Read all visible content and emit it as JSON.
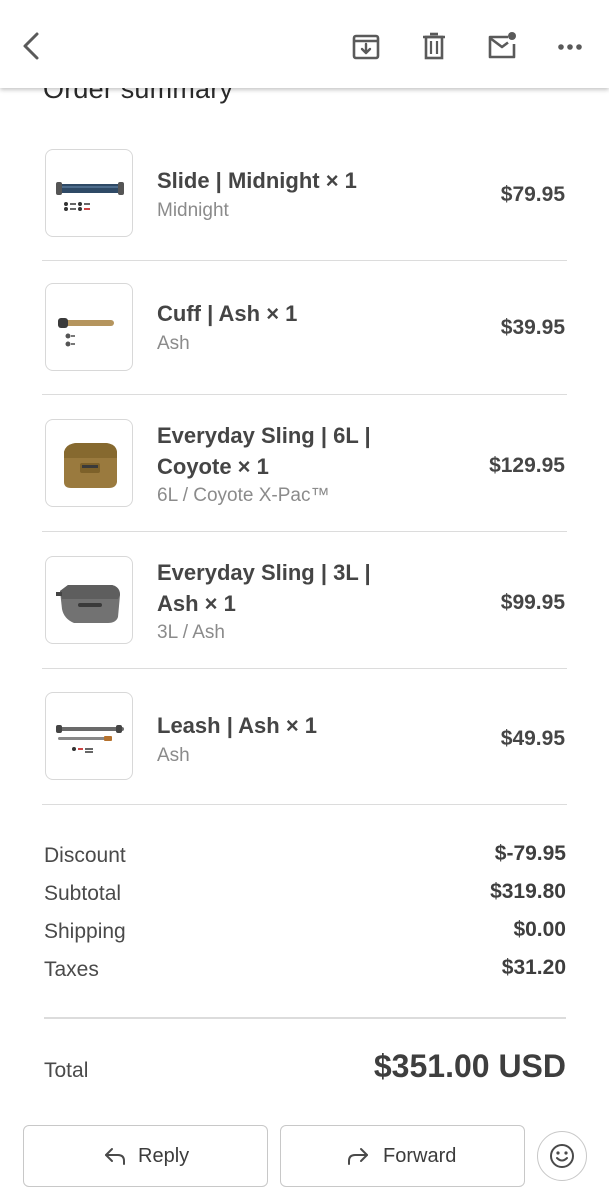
{
  "header": {
    "back_icon": "arrow-back-icon",
    "archive_icon": "archive-icon",
    "delete_icon": "trash-icon",
    "mark_unread_icon": "mail-unread-icon",
    "more_icon": "more-horizontal-icon"
  },
  "section_title": "Order summary",
  "items": [
    {
      "title": "Slide | Midnight × 1",
      "title_lines": [
        "Slide | Midnight × 1"
      ],
      "variant": "Midnight",
      "price": "$79.95",
      "thumb": "blue-strap"
    },
    {
      "title": "Cuff | Ash × 1",
      "title_lines": [
        "Cuff | Ash × 1"
      ],
      "variant": "Ash",
      "price": "$39.95",
      "thumb": "tan-cuff"
    },
    {
      "title": "Everyday Sling | 6L | Coyote × 1",
      "title_lines": [
        "Everyday Sling | 6L |",
        "Coyote × 1"
      ],
      "variant": "6L / Coyote X-Pac™",
      "price": "$129.95",
      "thumb": "coyote-bag"
    },
    {
      "title": "Everyday Sling | 3L | Ash × 1",
      "title_lines": [
        "Everyday Sling | 3L |",
        "Ash × 1"
      ],
      "variant": "3L / Ash",
      "price": "$99.95",
      "thumb": "gray-bag"
    },
    {
      "title": "Leash | Ash × 1",
      "title_lines": [
        "Leash | Ash × 1"
      ],
      "variant": "Ash",
      "price": "$49.95",
      "thumb": "gray-strap"
    }
  ],
  "totals": {
    "discount_label": "Discount",
    "discount_value": "$-79.95",
    "subtotal_label": "Subtotal",
    "subtotal_value": "$319.80",
    "shipping_label": "Shipping",
    "shipping_value": "$0.00",
    "taxes_label": "Taxes",
    "taxes_value": "$31.20",
    "total_label": "Total",
    "total_value": "$351.00 USD"
  },
  "actions": {
    "reply_label": "Reply",
    "forward_label": "Forward",
    "emoji_icon": "emoji-smile-icon"
  },
  "colors": {
    "text": "#454545",
    "muted": "#8b8b8b",
    "divider": "#dcdcdc",
    "coyote": "#9a7a3e",
    "midnight": "#2f4a66"
  }
}
